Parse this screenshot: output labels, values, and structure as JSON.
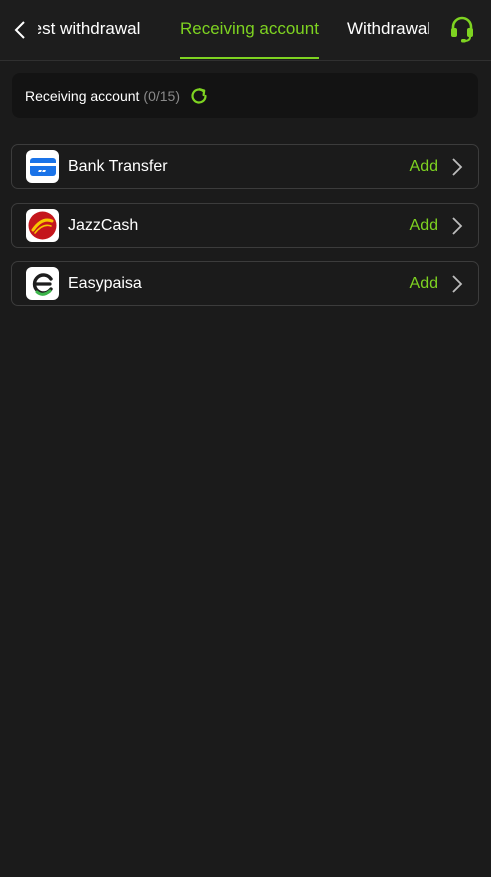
{
  "header": {
    "tabs": [
      {
        "label": "Request withdrawal"
      },
      {
        "label": "Receiving account"
      },
      {
        "label": "Withdrawal Records"
      }
    ],
    "active_tab": 1
  },
  "counter": {
    "label": "Receiving account",
    "count": "(0/15)"
  },
  "accounts": [
    {
      "name": "Bank Transfer",
      "action": "Add",
      "icon": "bank-card-icon"
    },
    {
      "name": "JazzCash",
      "action": "Add",
      "icon": "jazzcash-logo"
    },
    {
      "name": "Easypaisa",
      "action": "Add",
      "icon": "easypaisa-logo"
    }
  ],
  "colors": {
    "accent": "#7ed321",
    "background": "#1b1b1b",
    "bank_icon": "#1a73e8",
    "jazz_red": "#c4161c",
    "jazz_yellow": "#f7c600",
    "easypaisa_green": "#3bb54a"
  }
}
